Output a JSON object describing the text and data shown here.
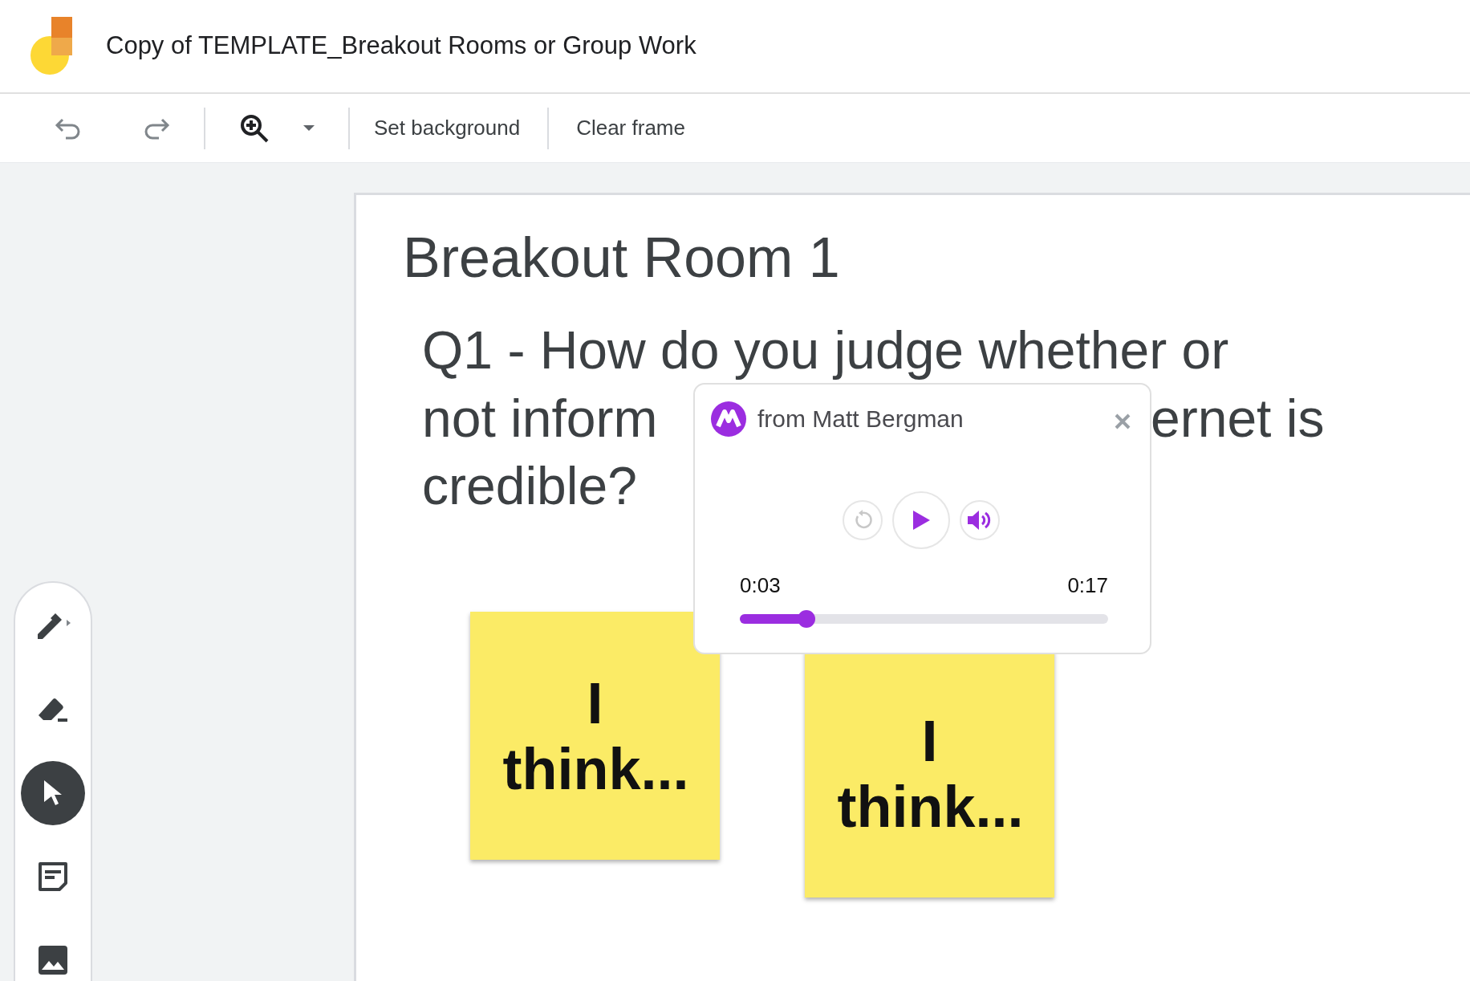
{
  "app": {
    "title": "Copy of TEMPLATE_Breakout Rooms or Group Work"
  },
  "toolbar": {
    "buttons": [
      {
        "label": "Set background"
      },
      {
        "label": "Clear frame"
      }
    ]
  },
  "tools": [
    {
      "kind": "pen",
      "selected": false
    },
    {
      "kind": "eraser",
      "selected": false
    },
    {
      "kind": "select",
      "selected": true
    },
    {
      "kind": "note",
      "selected": false
    },
    {
      "kind": "image",
      "selected": false
    }
  ],
  "frame": {
    "title": "Breakout Room 1",
    "question_lines": [
      "Q1 - How do you judge whether or",
      "not inform",
      "ernet is",
      "credible?"
    ],
    "sticky_notes": [
      {
        "text": "I think..."
      },
      {
        "text": "I think..."
      }
    ]
  },
  "audio_popup": {
    "sender": "from Matt Bergman",
    "elapsed": "0:03",
    "duration": "0:17",
    "level": 0.18
  }
}
